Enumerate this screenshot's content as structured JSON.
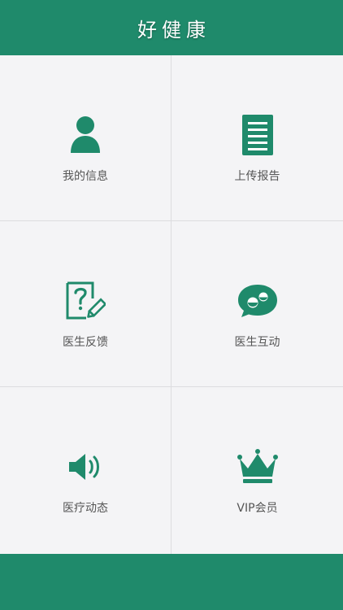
{
  "header": {
    "title": "好健康"
  },
  "colors": {
    "primary": "#1f8a6b",
    "background": "#f4f4f6",
    "label": "#555555",
    "divider": "#dcdcdf"
  },
  "menu": [
    {
      "label": "我的信息",
      "icon": "person-icon"
    },
    {
      "label": "上传报告",
      "icon": "document-icon"
    },
    {
      "label": "医生反馈",
      "icon": "question-edit-icon"
    },
    {
      "label": "医生互动",
      "icon": "chat-bubble-icon"
    },
    {
      "label": "医疗动态",
      "icon": "speaker-icon"
    },
    {
      "label": "VIP会员",
      "icon": "crown-icon"
    }
  ]
}
